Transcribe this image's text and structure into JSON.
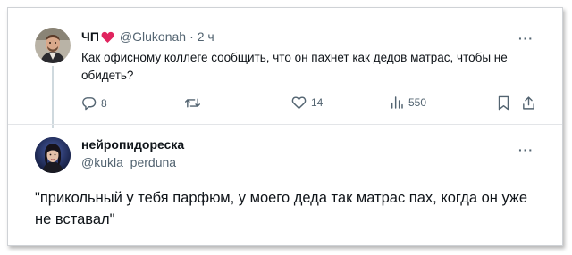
{
  "original_tweet": {
    "display_name": "ЧП",
    "handle": "@Glukonah",
    "separator": "·",
    "time": "2 ч",
    "text": "Как офисному коллеге сообщить, что он пахнет как дедов матрас, чтобы не обидеть?",
    "actions": {
      "replies": "8",
      "retweets": "",
      "likes": "14",
      "views": "550"
    },
    "heart_color": "#e0245e"
  },
  "reply_tweet": {
    "display_name": "нейропидореска",
    "handle": "@kukla_perduna",
    "text": "\"прикольный у тебя парфюм, у моего деда так матрас пах, когда он уже не вставал\""
  },
  "more_label": "···",
  "colors": {
    "text": "#0f1419",
    "muted": "#536471",
    "border": "#cfd2d6"
  }
}
